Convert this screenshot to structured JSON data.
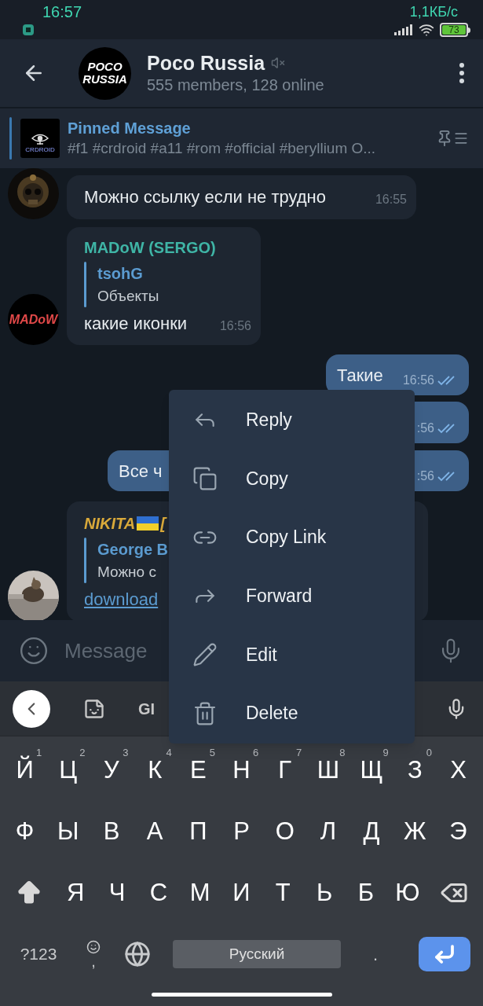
{
  "status_bar": {
    "time": "16:57",
    "speed": "1,1КБ/с",
    "battery": "73"
  },
  "header": {
    "title": "Poco Russia",
    "muted": true,
    "subtitle": "555 members, 128 online",
    "avatar_lines": [
      "POCO",
      "RUSSIA"
    ]
  },
  "pinned": {
    "title": "Pinned Message",
    "text": "#f1 #crdroid #a11 #rom #official #beryllium O...",
    "thumb_text": "CRDROID"
  },
  "messages": [
    {
      "kind": "incoming",
      "text": "Можно ссылку если не трудно",
      "time": "16:55"
    },
    {
      "kind": "incoming",
      "avatar": {
        "kind": "text",
        "text": "MADoW"
      },
      "sender": "MADoW (SERGO)",
      "color": "#3fb5a6",
      "reply": {
        "sender": "tsohG",
        "text": "Объекты"
      },
      "text": "какие иконки",
      "time": "16:56"
    },
    {
      "kind": "outgoing",
      "text": "Такие",
      "time": "16:56",
      "read": true
    },
    {
      "kind": "outgoing",
      "time": ":56",
      "read": true
    },
    {
      "kind": "outgoing",
      "text": "Все ч",
      "time": ":56",
      "read": true
    },
    {
      "kind": "incoming",
      "sender": "NIKITA",
      "sender_flag": true,
      "sender_suffix": "[",
      "color": "#d9a93a",
      "reply": {
        "sender": "George B",
        "text": "Можно с"
      },
      "link": "download"
    }
  ],
  "composer": {
    "placeholder": "Message"
  },
  "menu": [
    {
      "kind": "reply",
      "label": "Reply"
    },
    {
      "kind": "copy",
      "label": "Copy"
    },
    {
      "kind": "link",
      "label": "Copy Link"
    },
    {
      "kind": "forward",
      "label": "Forward"
    },
    {
      "kind": "edit",
      "label": "Edit"
    },
    {
      "kind": "delete",
      "label": "Delete"
    }
  ],
  "keyboard": {
    "toolbar_text": "GI",
    "top_row": [
      {
        "label": "Й",
        "hint": "1"
      },
      {
        "label": "Ц",
        "hint": "2"
      },
      {
        "label": "У",
        "hint": "3"
      },
      {
        "label": "К",
        "hint": "4"
      },
      {
        "label": "Е",
        "hint": "5"
      },
      {
        "label": "Н",
        "hint": "6"
      },
      {
        "label": "Г",
        "hint": "7"
      },
      {
        "label": "Ш",
        "hint": "8"
      },
      {
        "label": "Щ",
        "hint": "9"
      },
      {
        "label": "З",
        "hint": "0"
      },
      {
        "label": "Х"
      }
    ],
    "middle_row": [
      {
        "label": "Ф"
      },
      {
        "label": "Ы"
      },
      {
        "label": "В"
      },
      {
        "label": "А"
      },
      {
        "label": "П"
      },
      {
        "label": "Р"
      },
      {
        "label": "О"
      },
      {
        "label": "Л"
      },
      {
        "label": "Д"
      },
      {
        "label": "Ж"
      },
      {
        "label": "Э"
      }
    ],
    "bottom_row": [
      {
        "label": "Я"
      },
      {
        "label": "Ч"
      },
      {
        "label": "С"
      },
      {
        "label": "М"
      },
      {
        "label": "И"
      },
      {
        "label": "Т"
      },
      {
        "label": "Ь"
      },
      {
        "label": "Б"
      },
      {
        "label": "Ю"
      }
    ],
    "symbols": "?123",
    "comma": ",",
    "space": "Русский",
    "period": "."
  }
}
